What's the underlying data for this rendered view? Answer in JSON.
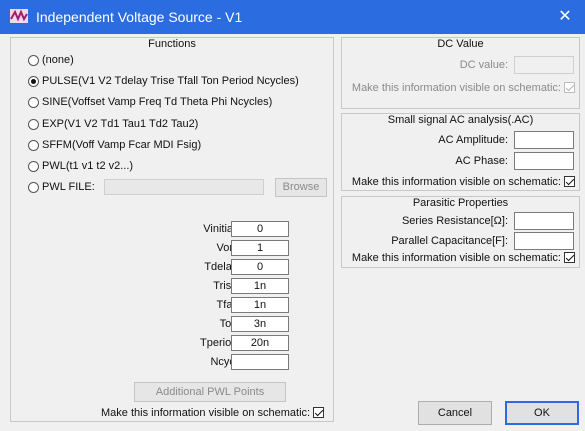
{
  "window": {
    "title": "Independent Voltage Source - V1",
    "close_glyph": "✕",
    "accent": "#2b6de0"
  },
  "functions": {
    "title": "Functions",
    "options": [
      {
        "label": "(none)",
        "checked": false
      },
      {
        "label": "PULSE(V1 V2 Tdelay Trise Tfall Ton Period Ncycles)",
        "checked": true
      },
      {
        "label": "SINE(Voffset Vamp Freq Td Theta Phi Ncycles)",
        "checked": false
      },
      {
        "label": "EXP(V1 V2 Td1 Tau1 Td2 Tau2)",
        "checked": false
      },
      {
        "label": "SFFM(Voff Vamp Fcar MDI Fsig)",
        "checked": false
      },
      {
        "label": "PWL(t1 v1 t2 v2...)",
        "checked": false
      },
      {
        "label": "PWL FILE:",
        "checked": false
      }
    ],
    "browse_label": "Browse",
    "params": [
      {
        "label": "Vinitial[V]:",
        "value": "0"
      },
      {
        "label": "Von[V]:",
        "value": "1"
      },
      {
        "label": "Tdelay[s]:",
        "value": "0"
      },
      {
        "label": "Trise[s]:",
        "value": "1n"
      },
      {
        "label": "Tfall[s]:",
        "value": "1n"
      },
      {
        "label": "Ton[s]:",
        "value": "3n"
      },
      {
        "label": "Tperiod[s]:",
        "value": "20n"
      },
      {
        "label": "Ncycles:",
        "value": ""
      }
    ],
    "additional_pwl_label": "Additional PWL Points",
    "visible_label": "Make this information visible on schematic:",
    "visible_checked": true
  },
  "dc": {
    "title": "DC Value",
    "value_label": "DC value:",
    "value": "",
    "visible_label": "Make this information visible on schematic:",
    "visible_checked": true
  },
  "ac": {
    "title": "Small signal AC analysis(.AC)",
    "amplitude_label": "AC Amplitude:",
    "amplitude": "",
    "phase_label": "AC Phase:",
    "phase": "",
    "visible_label": "Make this information visible on schematic:",
    "visible_checked": true
  },
  "parasitic": {
    "title": "Parasitic Properties",
    "series_label": "Series Resistance[Ω]:",
    "series": "",
    "parallel_label": "Parallel Capacitance[F]:",
    "parallel": "",
    "visible_label": "Make this information visible on schematic:",
    "visible_checked": true
  },
  "buttons": {
    "cancel": "Cancel",
    "ok": "OK"
  }
}
